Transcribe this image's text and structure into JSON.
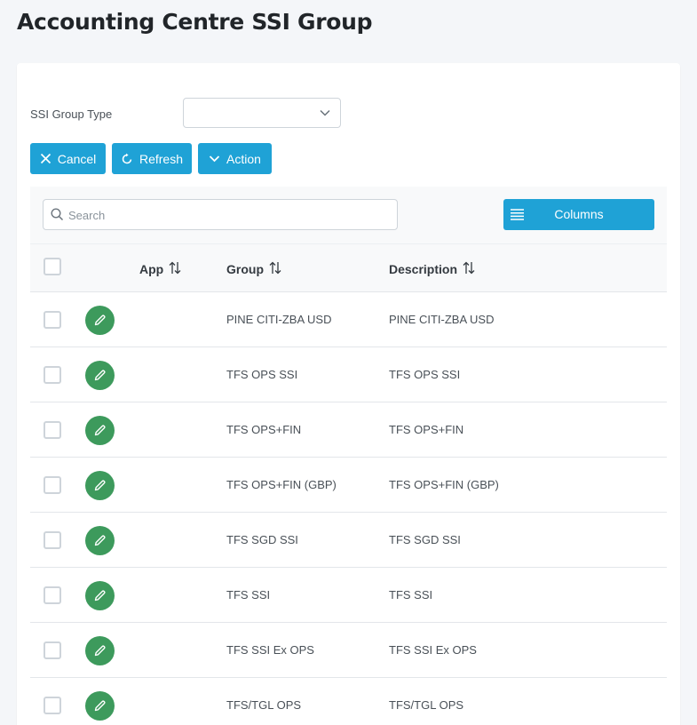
{
  "page": {
    "title": "Accounting Centre SSI Group"
  },
  "form": {
    "ssi_group_type_label": "SSI Group Type",
    "ssi_group_type_value": ""
  },
  "actions": {
    "cancel_label": "Cancel",
    "refresh_label": "Refresh",
    "action_label": "Action"
  },
  "table": {
    "search_placeholder": "Search",
    "columns_label": "Columns",
    "headers": {
      "app": "App",
      "group": "Group",
      "description": "Description"
    },
    "rows": [
      {
        "app": "",
        "group": "PINE CITI-ZBA USD",
        "description": "PINE CITI-ZBA USD"
      },
      {
        "app": "",
        "group": "TFS OPS SSI",
        "description": "TFS OPS SSI"
      },
      {
        "app": "",
        "group": "TFS OPS+FIN",
        "description": "TFS OPS+FIN"
      },
      {
        "app": "",
        "group": "TFS OPS+FIN (GBP)",
        "description": "TFS OPS+FIN (GBP)"
      },
      {
        "app": "",
        "group": "TFS SGD SSI",
        "description": "TFS SGD SSI"
      },
      {
        "app": "",
        "group": "TFS SSI",
        "description": "TFS SSI"
      },
      {
        "app": "",
        "group": "TFS SSI Ex OPS",
        "description": "TFS SSI Ex OPS"
      },
      {
        "app": "",
        "group": "TFS/TGL OPS",
        "description": "TFS/TGL OPS"
      }
    ]
  },
  "colors": {
    "primary": "#1fa2d6",
    "edit": "#3d9a5c",
    "background": "#f4f6f9"
  },
  "icons": {
    "cancel": "close-icon",
    "refresh": "refresh-icon",
    "action": "chevron-down-icon",
    "search": "search-icon",
    "columns": "list-icon",
    "sort": "sort-icon",
    "edit": "pencil-icon"
  }
}
